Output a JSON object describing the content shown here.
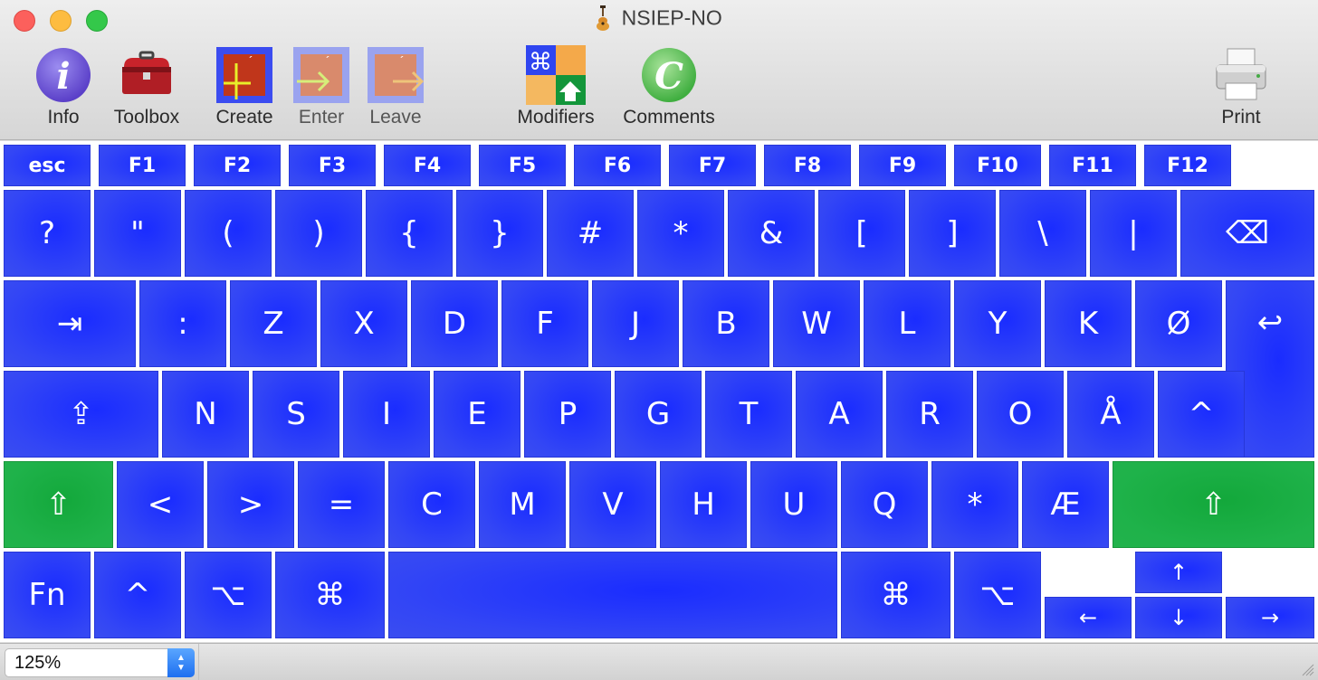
{
  "window": {
    "title": "NSIEP-NO"
  },
  "toolbar": {
    "info": "Info",
    "toolbox": "Toolbox",
    "create": "Create",
    "enter": "Enter",
    "leave": "Leave",
    "modifiers": "Modifiers",
    "comments": "Comments",
    "print": "Print"
  },
  "keys": {
    "esc": "esc",
    "f1": "F1",
    "f2": "F2",
    "f3": "F3",
    "f4": "F4",
    "f5": "F5",
    "f6": "F6",
    "f7": "F7",
    "f8": "F8",
    "f9": "F9",
    "f10": "F10",
    "f11": "F11",
    "f12": "F12",
    "row1": [
      "?",
      "\"",
      "(",
      ")",
      "{",
      "}",
      "#",
      "*",
      "&",
      "[",
      "]",
      "\\",
      "|"
    ],
    "delete": "⌫",
    "tab": "⇥",
    "row2": [
      ":",
      "Z",
      "X",
      "D",
      "F",
      "J",
      "B",
      "W",
      "L",
      "Y",
      "K",
      "Ø"
    ],
    "return": "↩",
    "caps": "⇪",
    "row3": [
      "N",
      "S",
      "I",
      "E",
      "P",
      "G",
      "T",
      "A",
      "R",
      "O",
      "Å",
      "^"
    ],
    "shift": "⇧",
    "row4": [
      "<",
      ">",
      "=",
      "C",
      "M",
      "V",
      "H",
      "U",
      "Q",
      "*",
      "Æ"
    ],
    "fn": "Fn",
    "control": "^",
    "option": "⌥",
    "command": "⌘",
    "space": "",
    "up": "↑",
    "left": "←",
    "down": "↓",
    "right": "→"
  },
  "colors": {
    "key": "#1a2cff",
    "shift_active": "#13a83b"
  },
  "status": {
    "zoom": "125%"
  }
}
